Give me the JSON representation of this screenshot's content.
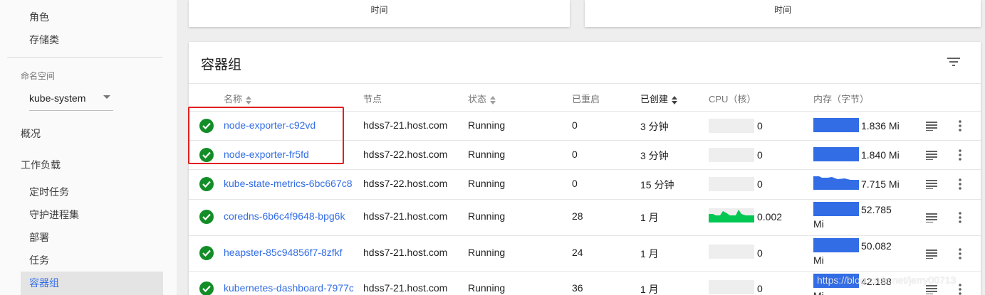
{
  "sidebar": {
    "items_top": [
      {
        "label": "角色"
      },
      {
        "label": "存储类"
      }
    ],
    "namespace_label": "命名空间",
    "namespace_value": "kube-system",
    "overview": "概况",
    "workloads": "工作负载",
    "workload_items": [
      {
        "label": "定时任务"
      },
      {
        "label": "守护进程集"
      },
      {
        "label": "部署"
      },
      {
        "label": "任务"
      },
      {
        "label": "容器组"
      }
    ]
  },
  "top_cards": [
    {
      "label": "时间"
    },
    {
      "label": "时间"
    }
  ],
  "pods": {
    "title": "容器组",
    "columns": {
      "name": "名称",
      "node": "节点",
      "status": "状态",
      "restarts": "已重启",
      "created": "已创建",
      "cpu": "CPU（核）",
      "memory": "内存（字节）"
    },
    "rows": [
      {
        "name": "node-exporter-c92vd",
        "node": "hdss7-21.host.com",
        "status": "Running",
        "restarts": "0",
        "created": "3 分钟",
        "cpu": "0",
        "mem_line1": "1.836 Mi",
        "mem_line2": ""
      },
      {
        "name": "node-exporter-fr5fd",
        "node": "hdss7-22.host.com",
        "status": "Running",
        "restarts": "0",
        "created": "3 分钟",
        "cpu": "0",
        "mem_line1": "1.840 Mi",
        "mem_line2": ""
      },
      {
        "name": "kube-state-metrics-6bc667c8",
        "node": "hdss7-22.host.com",
        "status": "Running",
        "restarts": "0",
        "created": "15 分钟",
        "cpu": "0",
        "mem_line1": "7.715 Mi",
        "mem_line2": ""
      },
      {
        "name": "coredns-6b6c4f9648-bpg6k",
        "node": "hdss7-21.host.com",
        "status": "Running",
        "restarts": "28",
        "created": "1 月",
        "cpu": "0.002",
        "mem_line1": "52.785",
        "mem_line2": "Mi"
      },
      {
        "name": "heapster-85c94856f7-8zfkf",
        "node": "hdss7-21.host.com",
        "status": "Running",
        "restarts": "24",
        "created": "1 月",
        "cpu": "0",
        "mem_line1": "50.082",
        "mem_line2": "Mi"
      },
      {
        "name": "kubernetes-dashboard-7977c",
        "node": "hdss7-21.host.com",
        "status": "Running",
        "restarts": "36",
        "created": "1 月",
        "cpu": "0",
        "mem_line1": "42.188",
        "mem_line2": "Mi"
      }
    ]
  },
  "watermark": "https://blog.csdn.net/jerry00713",
  "colors": {
    "accent": "#326de6",
    "success": "#138d27",
    "cpu_spark": "#00c752",
    "highlight": "#e02020"
  }
}
